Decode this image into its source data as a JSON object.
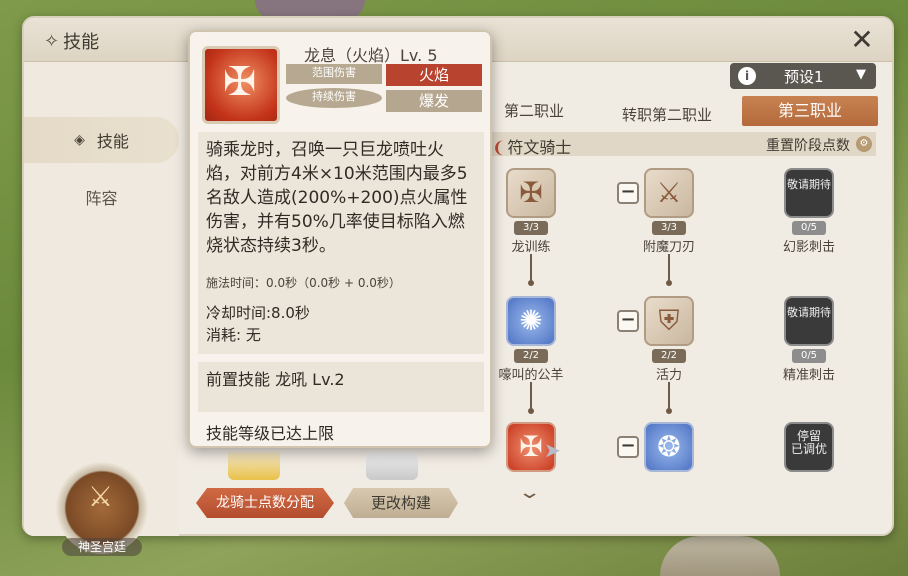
{
  "header": {
    "title": "技能",
    "close_icon": "close-icon"
  },
  "nav": {
    "items": [
      {
        "label": "技能",
        "icon": "skill-diamond-icon",
        "active": true
      },
      {
        "label": "阵容",
        "active": false
      }
    ],
    "emblem_label": "神圣宫廷"
  },
  "preset": {
    "label": "预设1",
    "info_icon": "i"
  },
  "tabs": [
    {
      "label": "第二职业"
    },
    {
      "label": "转职第二职业"
    },
    {
      "label": "第三职业",
      "active": true
    }
  ],
  "section": {
    "title": "符文骑士",
    "reset_label": "重置阶段点数"
  },
  "skill_nodes": [
    {
      "name": "龙训练",
      "count": "3/3",
      "kind": "beige"
    },
    {
      "name": "附魔刀刃",
      "count": "3/3",
      "kind": "beige"
    },
    {
      "name": "幻影刺击",
      "count": "0/5",
      "kind": "dark",
      "overlay": "敬请期待"
    },
    {
      "name": "嚎叫的公羊",
      "count": "2/2",
      "kind": "blue"
    },
    {
      "name": "活力",
      "count": "2/2",
      "kind": "beige"
    },
    {
      "name": "精准刺击",
      "count": "0/5",
      "kind": "dark",
      "overlay": "敬请期待"
    },
    {
      "kind": "fire"
    },
    {
      "kind": "blue"
    },
    {
      "kind": "dark",
      "overlay1": "停留",
      "overlay2": "已调优"
    }
  ],
  "buttons": {
    "distribute": "龙骑士点数分配",
    "build": "更改构建"
  },
  "tooltip": {
    "name": "龙息（火焰）Lv. 5",
    "tags": {
      "aoe": "范围伤害",
      "dot": "持续伤害",
      "fire": "火焰",
      "burst": "爆发"
    },
    "description": "骑乘龙时，召唤一只巨龙喷吐火焰，对前方4米×10米范围内最多5名敌人造成(200%+200)点火属性伤害，并有50%几率使目标陷入燃烧状态持续3秒。",
    "cast_time": "施法时间：0.0秒（0.0秒 + 0.0秒）",
    "cooldown": "冷却时间:8.0秒",
    "cost": "消耗: 无",
    "prerequisite": "前置技能 龙吼 Lv.2",
    "max_level": "技能等级已达上限"
  }
}
